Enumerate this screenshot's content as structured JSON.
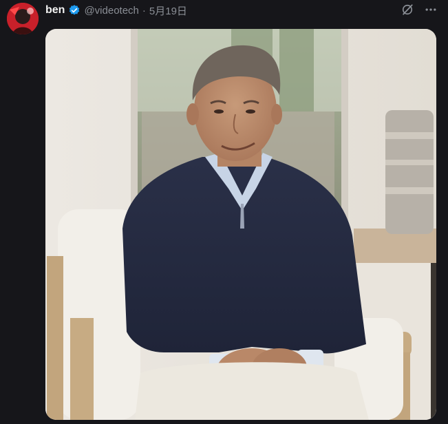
{
  "post": {
    "author": {
      "display_name": "ben",
      "verified": true,
      "handle": "@videotech",
      "avatar_icon": "avatar-photo"
    },
    "separator": "·",
    "timestamp": "5月19日",
    "actions": [
      {
        "icon": "grok-icon"
      },
      {
        "icon": "more-icon"
      }
    ],
    "media": {
      "kind": "photo",
      "subject": "man in navy sweater seated in white armchair"
    }
  },
  "colors": {
    "background": "#16161a",
    "name_text": "#f3f3f3",
    "muted_text": "#8b8f96",
    "verified_badge": "#1d9bf0",
    "avatar_red": "#d22"
  }
}
